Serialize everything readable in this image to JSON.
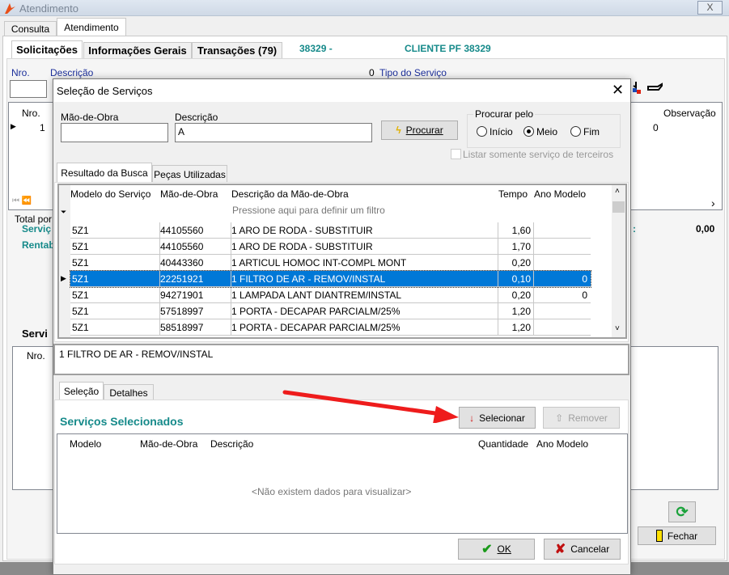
{
  "window": {
    "title": "Atendimento",
    "close": "X"
  },
  "outer_tabs": [
    {
      "label": "Consulta"
    },
    {
      "label": "Atendimento"
    }
  ],
  "inner_tabs": [
    {
      "label": "Solicitações"
    },
    {
      "label": "Informações Gerais"
    },
    {
      "label": "Transações (79)"
    }
  ],
  "header_info": {
    "code": "38329 -",
    "client": "CLIENTE PF 38329"
  },
  "form_labels": {
    "nro": "Nro.",
    "descricao": "Descrição",
    "count": "0",
    "tipo": "Tipo do Serviço"
  },
  "bg_grid": {
    "nro": "Nro.",
    "observacao": "Observação",
    "row_nro": "1",
    "row_val": "0"
  },
  "totals": {
    "total": "Total por",
    "servicos": "Serviç",
    "rentab": "Rentab",
    "colon": ":",
    "value": "0,00"
  },
  "servicos_section": {
    "title": "Servi",
    "nro": "Nro."
  },
  "fechar": "Fechar",
  "dialog": {
    "title": "Seleção de Serviços",
    "mao_label": "Mão-de-Obra",
    "mao_value": "",
    "desc_label": "Descrição",
    "desc_value": "A",
    "procurar": "Procurar",
    "procurar_pelo": "Procurar pelo",
    "radios": [
      {
        "label": "Início",
        "checked": false
      },
      {
        "label": "Meio",
        "checked": true
      },
      {
        "label": "Fim",
        "checked": false
      }
    ],
    "terceiros": "Listar somente serviço de terceiros",
    "tabs": [
      {
        "label": "Resultado da Busca"
      },
      {
        "label": "Peças Utilizadas"
      }
    ],
    "columns": [
      "Modelo do Serviço",
      "Mão-de-Obra",
      "Descrição da Mão-de-Obra",
      "Tempo",
      "Ano Modelo"
    ],
    "filter_hint": "Pressione aqui para definir um filtro",
    "rows": [
      [
        "5Z1",
        "44105560",
        "1 ARO DE RODA   -   SUBSTITUIR",
        "1,60",
        ""
      ],
      [
        "5Z1",
        "44105560",
        "1 ARO DE RODA   -   SUBSTITUIR",
        "1,70",
        ""
      ],
      [
        "5Z1",
        "40443360",
        "1 ARTICUL HOMOC INT-COMPL MONT",
        "0,20",
        ""
      ],
      [
        "5Z1",
        "22251921",
        "1 FILTRO DE AR  -  REMOV/INSTAL",
        "0,10",
        "0"
      ],
      [
        "5Z1",
        "94271901",
        "1 LAMPADA LANT DIANTREM/INSTAL",
        "0,20",
        "0"
      ],
      [
        "5Z1",
        "57518997",
        "1 PORTA - DECAPAR PARCIALM/25%",
        "1,20",
        ""
      ],
      [
        "5Z1",
        "58518997",
        "1 PORTA - DECAPAR PARCIALM/25%",
        "1,20",
        ""
      ]
    ],
    "selected_row": 3,
    "memo": "1 FILTRO DE AR  -  REMOV/INSTAL",
    "bottom_tabs": [
      {
        "label": "Seleção"
      },
      {
        "label": "Detalhes"
      }
    ],
    "selected_title": "Serviços Selecionados",
    "selecionar": "Selecionar",
    "remover": "Remover",
    "sel_columns": [
      "Modelo",
      "Mão-de-Obra",
      "Descrição",
      "Quantidade",
      "Ano Modelo"
    ],
    "empty": "<Não existem dados para visualizar>",
    "ok": "OK",
    "cancelar": "Cancelar"
  },
  "colors": {
    "accent": "#0078d7",
    "teal": "#168a8a",
    "arrow": "#ee1c1c"
  }
}
